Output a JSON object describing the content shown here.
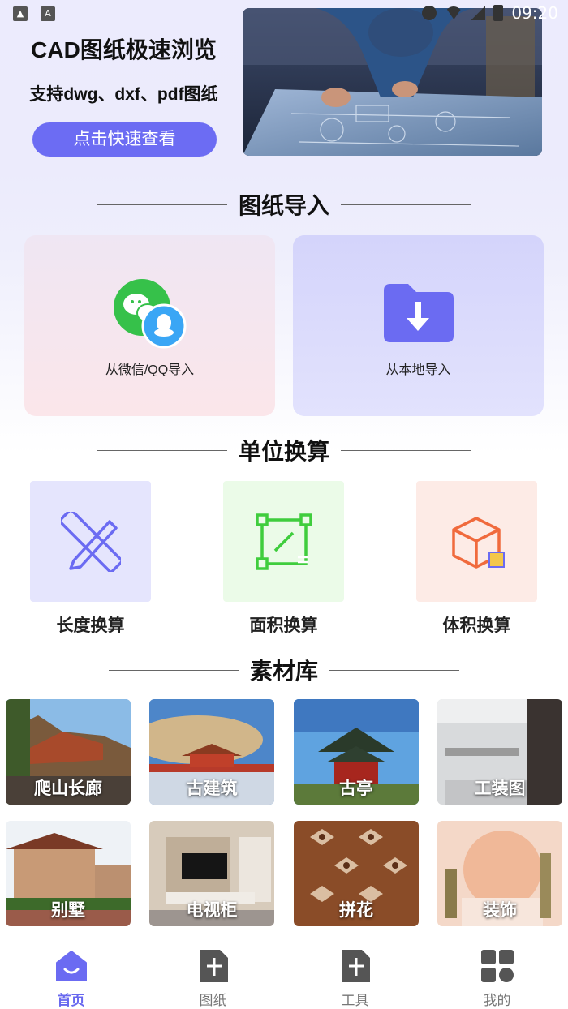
{
  "status_bar": {
    "time": "09:20"
  },
  "banner": {
    "title": "CAD图纸极速浏览",
    "subtitle": "支持dwg、dxf、pdf图纸",
    "button": "点击快速查看"
  },
  "import_section": {
    "title": "图纸导入",
    "wechat_label": "从微信/QQ导入",
    "local_label": "从本地导入"
  },
  "unit_section": {
    "title": "单位换算",
    "items": [
      {
        "label": "长度换算",
        "icon": "ruler-pencil-icon",
        "bg": "#e5e5fd"
      },
      {
        "label": "面积换算",
        "icon": "area-edit-icon",
        "bg": "#ebfbe8"
      },
      {
        "label": "体积换算",
        "icon": "cube-icon",
        "bg": "#fdebe6"
      }
    ]
  },
  "material_section": {
    "title": "素材库",
    "items": [
      {
        "label": "爬山长廊"
      },
      {
        "label": "古建筑"
      },
      {
        "label": "古亭"
      },
      {
        "label": "工装图"
      },
      {
        "label": "别墅"
      },
      {
        "label": "电视柜"
      },
      {
        "label": "拼花"
      },
      {
        "label": "装饰"
      }
    ]
  },
  "bottom_nav": {
    "items": [
      {
        "label": "首页",
        "icon": "home-icon",
        "active": true
      },
      {
        "label": "图纸",
        "icon": "drawing-icon",
        "active": false
      },
      {
        "label": "工具",
        "icon": "tools-icon",
        "active": false
      },
      {
        "label": "我的",
        "icon": "profile-grid-icon",
        "active": false
      }
    ]
  },
  "colors": {
    "accent": "#6c6cf3",
    "wechat_green": "#36c14a",
    "qq_blue": "#3aa6f5",
    "area_green": "#3fcd3d",
    "cube_orange": "#f06a3d"
  }
}
